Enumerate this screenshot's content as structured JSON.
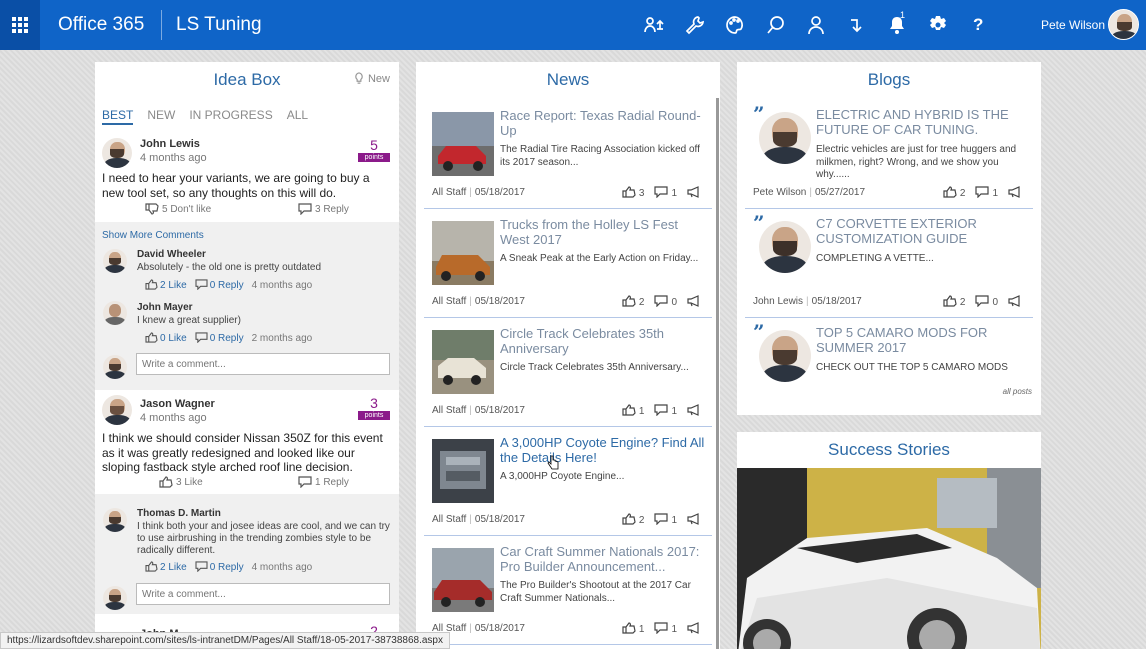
{
  "topbar": {
    "app_name": "Office 365",
    "site_name": "LS Tuning",
    "notification_count": "1",
    "user_name": "Pete Wilson",
    "icons": [
      "network-icon",
      "wrench-icon",
      "palette-icon",
      "search-icon",
      "person-icon",
      "redirect-icon",
      "bell-icon",
      "gear-icon",
      "help-icon"
    ],
    "help_label": "?",
    "accent": "#0f64c8"
  },
  "idea_box": {
    "title": "Idea Box",
    "new_label": "New",
    "tabs": [
      "BEST",
      "NEW",
      "IN PROGRESS",
      "ALL"
    ],
    "posts": [
      {
        "author": "John Lewis",
        "time": "4 months ago",
        "points": "5",
        "points_label": "points",
        "text": "I need to hear your variants, we are going to buy a new tool set, so any thoughts on this will do.",
        "dislike": "5 Don't like",
        "reply": "3 Reply",
        "show_more": "Show More Comments",
        "comments": [
          {
            "author": "David Wheeler",
            "text": "Absolutely - the old one is pretty outdated",
            "like": "2 Like",
            "reply": "0 Reply",
            "time": "4 months ago"
          },
          {
            "author": "John Mayer",
            "text": "I knew a great supplier)",
            "like": "0 Like",
            "reply": "0 Reply",
            "time": "2 months ago"
          }
        ],
        "comment_placeholder": "Write a comment..."
      },
      {
        "author": "Jason Wagner",
        "time": "4 months ago",
        "points": "3",
        "points_label": "points",
        "text": "I think we should consider Nissan 350Z for this event as it was greatly redesigned and looked like our sloping fastback style arched roof line decision.",
        "like": "3 Like",
        "reply": "1 Reply",
        "comments": [
          {
            "author": "Thomas D. Martin",
            "text": "I think both your and josee ideas are cool, and we can try to use airbrushing in the trending zombies style to be radically different.",
            "like": "2 Like",
            "reply": "0 Reply",
            "time": "4 months ago"
          }
        ],
        "comment_placeholder": "Write a comment..."
      }
    ],
    "partial_author": "John M",
    "partial_points": "2"
  },
  "news": {
    "title": "News",
    "items": [
      {
        "title": "Race Report: Texas Radial Round-Up",
        "summary": "The Radial Tire Racing Association kicked off its 2017 season...",
        "author": "All Staff",
        "date": "05/18/2017",
        "likes": "3",
        "comments": "1"
      },
      {
        "title": "Trucks from the Holley LS Fest West 2017",
        "summary": "A Sneak Peak at the Early Action on Friday...",
        "author": "All Staff",
        "date": "05/18/2017",
        "likes": "2",
        "comments": "0"
      },
      {
        "title": "Circle Track Celebrates 35th Anniversary",
        "summary": "Circle Track Celebrates 35th Anniversary...",
        "author": "All Staff",
        "date": "05/18/2017",
        "likes": "1",
        "comments": "1"
      },
      {
        "title": "A 3,000HP Coyote Engine? Find All the Details Here!",
        "summary": "A 3,000HP Coyote Engine...",
        "author": "All Staff",
        "date": "05/18/2017",
        "likes": "2",
        "comments": "1"
      },
      {
        "title": "Car Craft Summer Nationals 2017: Pro Builder Announcement...",
        "summary": "The Pro Builder's Shootout at the 2017 Car Craft Summer Nationals...",
        "author": "All Staff",
        "date": "05/18/2017",
        "likes": "1",
        "comments": "1"
      }
    ]
  },
  "blogs": {
    "title": "Blogs",
    "items": [
      {
        "title": "ELECTRIC AND HYBRID IS THE FUTURE OF CAR TUNING.",
        "summary": "Electric vehicles are just for tree huggers and milkmen, right? Wrong, and we show you why......",
        "author": "Pete Wilson",
        "date": "05/27/2017",
        "likes": "2",
        "comments": "1"
      },
      {
        "title": "C7 CORVETTE EXTERIOR CUSTOMIZATION GUIDE",
        "summary": "COMPLETING A VETTE...",
        "author": "John Lewis",
        "date": "05/18/2017",
        "likes": "2",
        "comments": "0"
      },
      {
        "title": "TOP 5 CAMARO MODS FOR SUMMER 2017",
        "summary": "CHECK OUT THE TOP 5 CAMARO MODS FOR SUMMER 2017"
      }
    ],
    "all_posts": "all posts"
  },
  "success_stories": {
    "title": "Success Stories"
  },
  "status_bar": {
    "url": "https://lizardsoftdev.sharepoint.com/sites/ls-intranetDM/Pages/All Staff/18-05-2017-38738868.aspx"
  }
}
